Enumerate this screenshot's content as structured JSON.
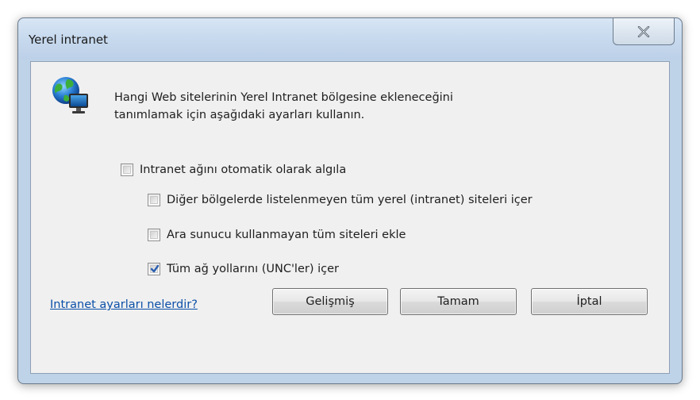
{
  "dialog": {
    "title": "Yerel intranet",
    "close_icon": "close-x-icon"
  },
  "info": {
    "icon": "network-globe-icon",
    "line1": "Hangi Web sitelerinin Yerel Intranet bölgesine ekleneceğini",
    "line2": "tanımlamak için aşağıdaki ayarları kullanın."
  },
  "checkboxes": [
    {
      "label": "Intranet ağını otomatik olarak algıla",
      "checked": false
    },
    {
      "label": "Diğer bölgelerde listelenmeyen tüm yerel (intranet) siteleri içer",
      "checked": false
    },
    {
      "label": "Ara sunucu kullanmayan tüm siteleri ekle",
      "checked": false
    },
    {
      "label": "Tüm ağ yollarını (UNC'ler) içer",
      "checked": true
    }
  ],
  "footer": {
    "help_link": "Intranet ayarları nelerdir?",
    "advanced_button": "Gelişmiş",
    "ok_button": "Tamam",
    "cancel_button": "İptal"
  },
  "colors": {
    "frame": "#bfd3e8",
    "content_bg": "#f0f0f0",
    "link": "#0b4fa8",
    "check_mark": "#2a5fb0"
  }
}
